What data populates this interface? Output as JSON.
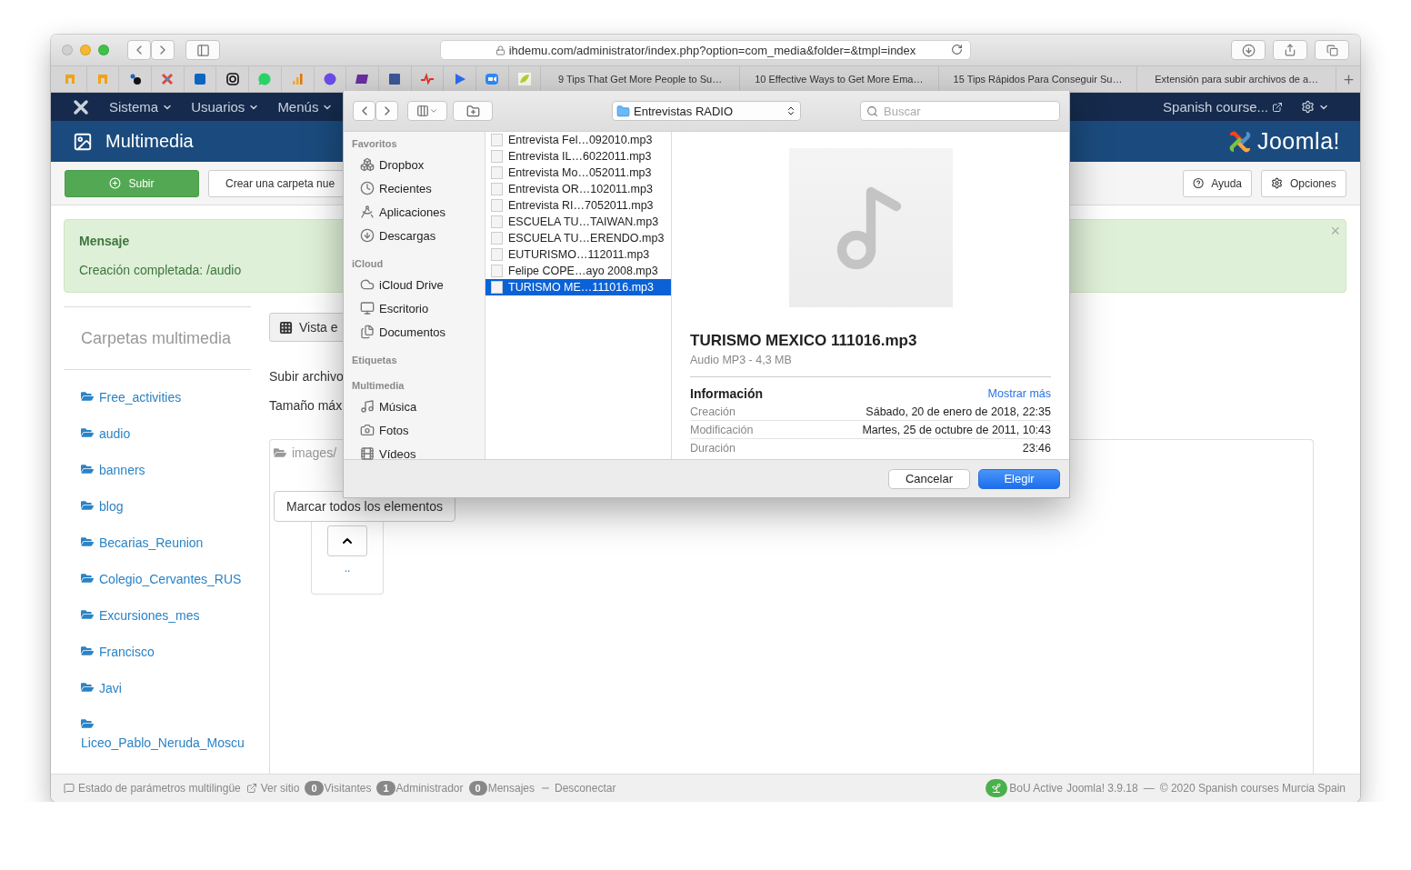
{
  "browser": {
    "url": "ihdemu.com/administrator/index.php?option=com_media&folder=&tmpl=index",
    "tabs": [
      {
        "label": "9 Tips That Get More People to Su…"
      },
      {
        "label": "10 Effective Ways to Get More Ema…"
      },
      {
        "label": "15 Tips Rápidos Para Conseguir Su…"
      },
      {
        "label": "Extensión para subir archivos de a…"
      }
    ]
  },
  "admin_menu": {
    "items": [
      "Sistema",
      "Usuarios",
      "Menús"
    ],
    "site_link": "Spanish course..."
  },
  "header": {
    "title": "Multimedia",
    "logo": "Joomla!"
  },
  "toolbar": {
    "left": [
      {
        "label": "Subir",
        "kind": "primary"
      },
      {
        "label": "Crear una carpeta nue",
        "kind": "default"
      }
    ],
    "right": [
      {
        "label": "Ayuda"
      },
      {
        "label": "Opciones"
      }
    ]
  },
  "message": {
    "title": "Mensaje",
    "text": "Creación completada: /audio",
    "close": "×"
  },
  "sidebar": {
    "title": "Carpetas multimedia",
    "folders": [
      "Free_activities",
      "audio",
      "banners",
      "blog",
      "Becarias_Reunion",
      "Colegio_Cervantes_RUS",
      "Excursiones_mes",
      "Francisco",
      "Javi",
      "Liceo_Pablo_Neruda_Moscu"
    ]
  },
  "main": {
    "view_button": "Vista e",
    "upload_label": "Subir archivo",
    "max_size": "Tamaño máx",
    "path": "images/",
    "select_all": "Marcar todos los elementos",
    "up_label": ".."
  },
  "dialog": {
    "location": "Entrevistas RADIO",
    "search_placeholder": "Buscar",
    "sidebar": [
      {
        "heading": "Favoritos",
        "items": [
          "Dropbox",
          "Recientes",
          "Aplicaciones",
          "Descargas"
        ]
      },
      {
        "heading": "iCloud",
        "items": [
          "iCloud Drive",
          "Escritorio",
          "Documentos"
        ]
      },
      {
        "heading": "Etiquetas"
      },
      {
        "heading": "Multimedia",
        "items": [
          "Música",
          "Fotos",
          "Vídeos"
        ]
      }
    ],
    "files": [
      {
        "name": "Entrevista Fel…092010.mp3",
        "selected": false
      },
      {
        "name": "Entrevista IL…6022011.mp3",
        "selected": false
      },
      {
        "name": "Entrevista Mo…052011.mp3",
        "selected": false
      },
      {
        "name": "Entrevista OR…102011.mp3",
        "selected": false
      },
      {
        "name": "Entrevista RI…7052011.mp3",
        "selected": false
      },
      {
        "name": "ESCUELA TU…TAIWAN.mp3",
        "selected": false
      },
      {
        "name": "ESCUELA TU…ERENDO.mp3",
        "selected": false
      },
      {
        "name": "EUTURISMO…112011.mp3",
        "selected": false
      },
      {
        "name": "Felipe COPE…ayo 2008.mp3",
        "selected": false
      },
      {
        "name": "TURISMO ME…111016.mp3",
        "selected": true
      }
    ],
    "preview": {
      "title": "TURISMO MEXICO 111016.mp3",
      "subtitle": "Audio MP3 - 4,3 MB",
      "info_heading": "Información",
      "more": "Mostrar más",
      "rows": [
        {
          "label": "Creación",
          "value": "Sábado, 20 de enero de 2018, 22:35"
        },
        {
          "label": "Modificación",
          "value": "Martes, 25 de octubre de 2011, 10:43"
        },
        {
          "label": "Duración",
          "value": "23:46"
        }
      ]
    },
    "buttons": [
      {
        "label": "Cancelar",
        "kind": "secondary"
      },
      {
        "label": "Elegir",
        "kind": "primary"
      }
    ]
  },
  "status_bar": {
    "left": [
      {
        "kind": "link",
        "label": "Estado de parámetros multilingüe"
      },
      {
        "kind": "link",
        "label": "Ver sitio"
      },
      {
        "kind": "count",
        "count": "0",
        "label": "Visitantes"
      },
      {
        "kind": "count",
        "count": "1",
        "label": "Administrador"
      },
      {
        "kind": "count",
        "count": "0",
        "label": "Mensajes"
      },
      {
        "kind": "link",
        "label": "Desconectar"
      }
    ],
    "right": [
      "BoU Active",
      "Joomla! 3.9.18",
      "—",
      "© 2020 Spanish courses Murcia Spain"
    ]
  }
}
